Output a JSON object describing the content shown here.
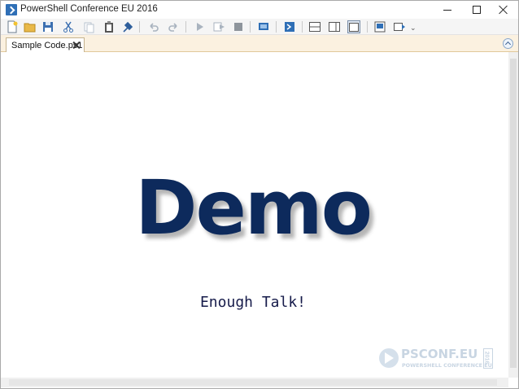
{
  "window": {
    "title": "PowerShell Conference EU 2016",
    "app_icon": "powershell-icon"
  },
  "window_controls": [
    "minimize",
    "maximize",
    "close"
  ],
  "toolbar": {
    "buttons": [
      "new-file-icon",
      "open-folder-icon",
      "save-icon",
      "cut-icon",
      "copy-icon",
      "paste-icon",
      "clear-console-icon",
      "undo-icon",
      "redo-icon",
      "run-script-icon",
      "run-selection-icon",
      "stop-icon",
      "new-remote-tab-icon",
      "start-powershell-icon",
      "show-script-pane-top-icon",
      "show-script-pane-right-icon",
      "show-script-pane-maximized-icon",
      "show-command-window-icon",
      "show-command-addon-icon",
      "more-icon"
    ]
  },
  "tabs": [
    {
      "label": "Sample Code.ps1",
      "active": true
    }
  ],
  "editor": {
    "heading": "Demo",
    "subheading": "Enough Talk!",
    "heading_color": "#0d2a5c"
  },
  "watermark": {
    "title": "PSCONF.EU",
    "subtitle": "POWERSHELL CONFERENCE EU",
    "year": "2016"
  },
  "colors": {
    "tab_strip": "#fbf1e0",
    "accent_blue": "#2f6fb6"
  }
}
